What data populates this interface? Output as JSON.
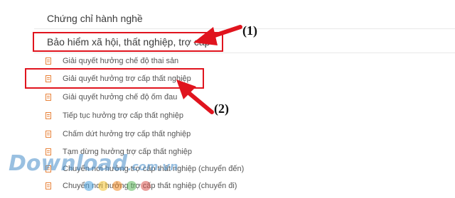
{
  "sections": {
    "first_title": "Chứng chỉ hành nghề",
    "second_title": "Bảo hiểm xã hội, thất nghiệp, trợ cấp"
  },
  "items": [
    {
      "label": "Giải quyết hưởng chế độ thai sản"
    },
    {
      "label": "Giải quyết hưởng trợ cấp thất nghiệp"
    },
    {
      "label": "Giải quyết hưởng chế độ ốm đau"
    },
    {
      "label": "Tiếp tục hưởng trợ cấp thất nghiệp"
    },
    {
      "label": "Chấm dứt hưởng trợ cấp thất nghiệp"
    },
    {
      "label": "Tạm dừng hưởng trợ cấp thất nghiệp"
    },
    {
      "label": "Chuyển nơi hưởng trợ cấp thất nghiệp (chuyển đến)"
    },
    {
      "label": "Chuyển nơi hưởng trợ cấp thất nghiệp (chuyển đi)"
    }
  ],
  "annotations": {
    "marker_1": "(1)",
    "marker_2": "(2)"
  },
  "watermark": {
    "text": "Download",
    "suffix": ".com.vn"
  },
  "colors": {
    "highlight_red": "#e0141e",
    "icon_orange": "#e8833a",
    "watermark_blue": "#468cc8"
  },
  "icons": {
    "item_icon": "document-icon",
    "arrow_icon": "arrow-icon"
  }
}
